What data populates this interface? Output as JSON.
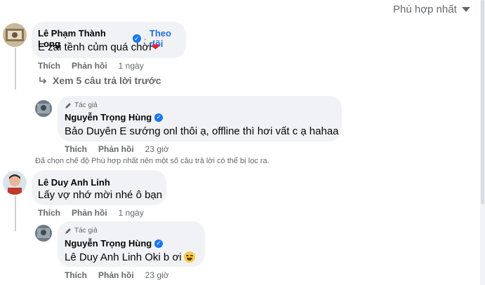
{
  "sort": {
    "label": "Phù hợp nhất",
    "icon": "caret-down-icon"
  },
  "comments": [
    {
      "author": "Lê Phạm Thành Long",
      "verified": true,
      "follow": "Theo dõi",
      "separator": "·",
      "text": "E zai tềnh củm quá chời",
      "reaction": "❤",
      "like": "Thích",
      "reply": "Phản hồi",
      "time": "1 ngày"
    },
    {
      "author": "Lê Duy Anh Linh",
      "text": "Lấy vợ nhớ mời nhé ô bạn",
      "like": "Thích",
      "reply": "Phản hồi",
      "time": "1 ngày"
    }
  ],
  "view_more": {
    "label": "Xem 5 câu trả lời trước",
    "icon": "reply-arrow-icon"
  },
  "replies": [
    {
      "tag": "Tác giả",
      "author": "Nguyễn Trọng Hùng",
      "verified": true,
      "mention": "Bảo Duyên",
      "text": " E sướng onl thôi ạ, offline thì hơi vất c ạ hahaa",
      "like": "Thích",
      "reply": "Phản hồi",
      "time": "23 giờ"
    },
    {
      "tag": "Tác giả",
      "author": "Nguyễn Trọng Hùng",
      "verified": true,
      "mention": "Lê Duy Anh Linh",
      "text": " Oki b ơi",
      "emoji": "grinning-face-icon",
      "like": "Thích",
      "reply": "Phản hồi",
      "time": "23 giờ"
    }
  ],
  "filter_note": "Đã chọn chế độ Phù hợp nhất nên một số câu trả lời có thể bị lọc ra.",
  "colors": {
    "link": "#216fdb",
    "bubble": "#f0f2f5",
    "meta": "#65676b",
    "verified": "#1877f2",
    "heart": "#e41e3f"
  }
}
